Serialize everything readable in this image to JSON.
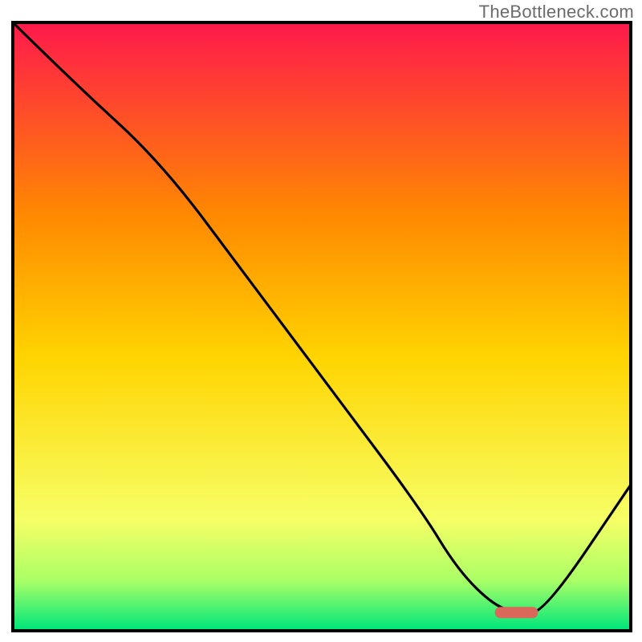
{
  "watermark": "TheBottleneck.com",
  "chart_data": {
    "type": "line",
    "title": "",
    "xlabel": "",
    "ylabel": "",
    "xlim": [
      0,
      100
    ],
    "ylim": [
      0,
      100
    ],
    "grid": false,
    "legend": false,
    "series": [
      {
        "name": "curve",
        "x": [
          0,
          10,
          24,
          38,
          52,
          66,
          72,
          78,
          82,
          86,
          100
        ],
        "y": [
          100,
          90,
          77,
          58,
          39,
          20,
          10,
          4,
          3,
          3,
          24
        ]
      }
    ],
    "highlight": {
      "x_start": 78,
      "x_end": 85,
      "y": 3
    },
    "annotations": [],
    "colors": {
      "grad_top": "#ff1a4b",
      "grad_mid1": "#ff8a00",
      "grad_mid2": "#ffd400",
      "grad_mid3": "#f6ff66",
      "grad_mid4": "#aaff66",
      "grad_bottom": "#00e67a",
      "curve": "#000000",
      "frame": "#000000",
      "highlight": "#d9675a"
    }
  }
}
